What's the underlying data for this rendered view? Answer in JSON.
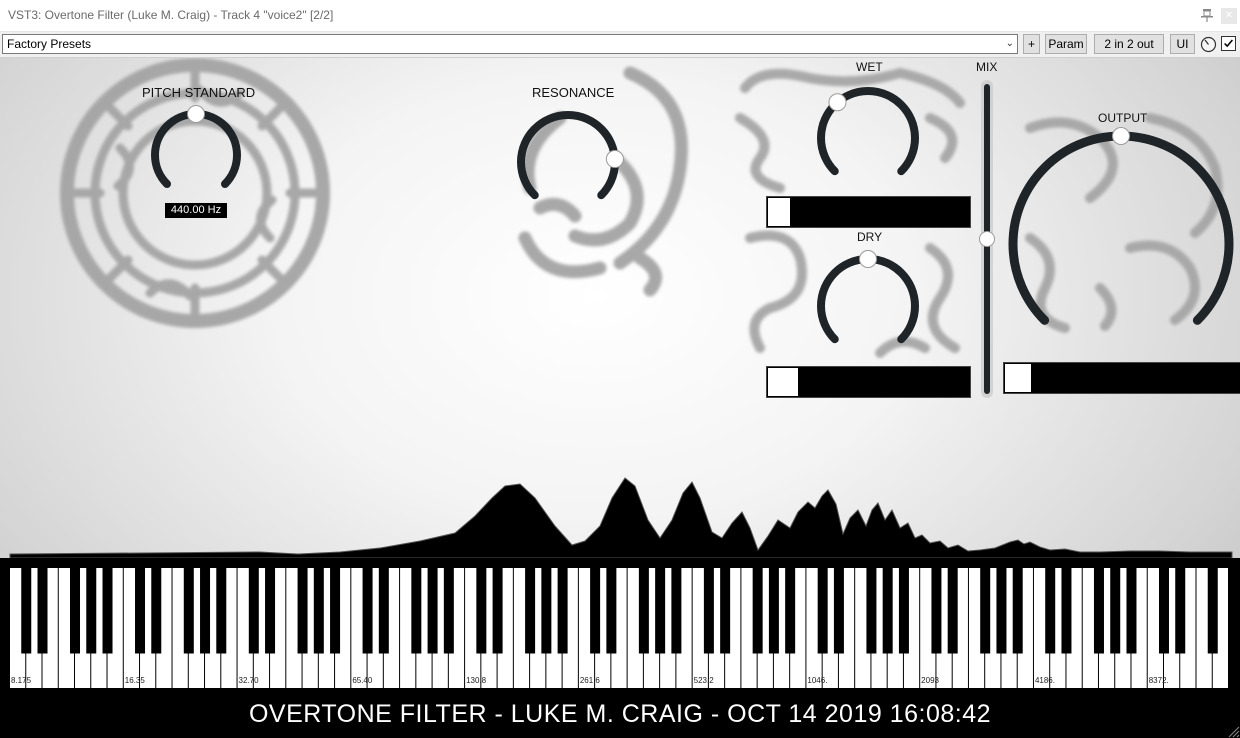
{
  "window": {
    "title": "VST3: Overtone Filter (Luke M. Craig) - Track 4 \"voice2\" [2/2]"
  },
  "toolbar": {
    "preset": "Factory Presets",
    "plus_label": "+",
    "param_label": "Param",
    "io_label": "2 in 2 out",
    "ui_label": "UI",
    "checkbox_checked": true
  },
  "plugin": {
    "pitch_standard": {
      "label": "PITCH STANDARD",
      "value_text": "440.00 Hz",
      "position": 0.5
    },
    "resonance": {
      "label": "RESONANCE",
      "position": 0.82
    },
    "wet": {
      "label": "WET",
      "knob_position": 0.35,
      "meter_level": 0.11
    },
    "mix": {
      "label": "MIX",
      "position": 0.5
    },
    "dry": {
      "label": "DRY",
      "knob_position": 0.5,
      "meter_level": 0.15
    },
    "output": {
      "label": "OUTPUT",
      "knob_position": 0.5,
      "meter_level": 0.11
    }
  },
  "keyboard": {
    "frequency_labels": [
      "8.175",
      "16.35",
      "32.70",
      "65.40",
      "130.8",
      "261.6",
      "523.2",
      "1046.",
      "2093",
      "4186.",
      "8372."
    ],
    "highlighted_black_key_index": 56,
    "highlight_color": "#b8a800"
  },
  "footer": {
    "text": "OVERTONE FILTER - LUKE M. CRAIG - OCT 14 2019 16:08:42"
  },
  "colors": {
    "knob_arc": "#1e2428",
    "knob_dot": "#ffffff",
    "footer_bg": "#000000"
  }
}
